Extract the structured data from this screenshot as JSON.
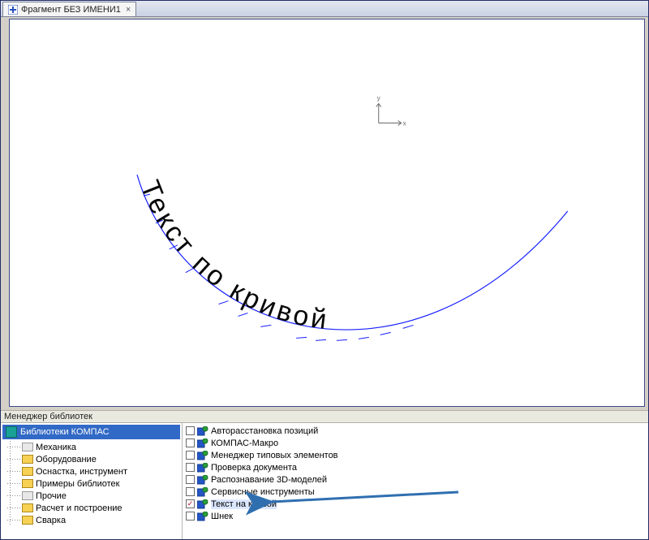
{
  "tab": {
    "title": "Фрагмент БЕЗ ИМЕНИ1"
  },
  "canvas": {
    "axis_x": "x",
    "axis_y": "y",
    "curve_text": "Текст по кривой"
  },
  "lib_manager": {
    "title": "Менеджер библиотек",
    "root": "Библиотеки КОМПАС",
    "folders": [
      {
        "label": "Механика",
        "grey": true
      },
      {
        "label": "Оборудование",
        "grey": false
      },
      {
        "label": "Оснастка, инструмент",
        "grey": false
      },
      {
        "label": "Примеры библиотек",
        "grey": false
      },
      {
        "label": "Прочие",
        "grey": true
      },
      {
        "label": "Расчет и построение",
        "grey": false
      },
      {
        "label": "Сварка",
        "grey": false
      }
    ],
    "modules": [
      {
        "label": "Авторасстановка позиций",
        "checked": false
      },
      {
        "label": "КОМПАС-Макро",
        "checked": false
      },
      {
        "label": "Менеджер типовых элементов",
        "checked": false
      },
      {
        "label": "Проверка документа",
        "checked": false
      },
      {
        "label": "Распознавание 3D-моделей",
        "checked": false
      },
      {
        "label": "Сервисные инструменты",
        "checked": false
      },
      {
        "label": "Текст на кривой",
        "checked": true,
        "selected": true
      },
      {
        "label": "Шнек",
        "checked": false
      }
    ]
  }
}
